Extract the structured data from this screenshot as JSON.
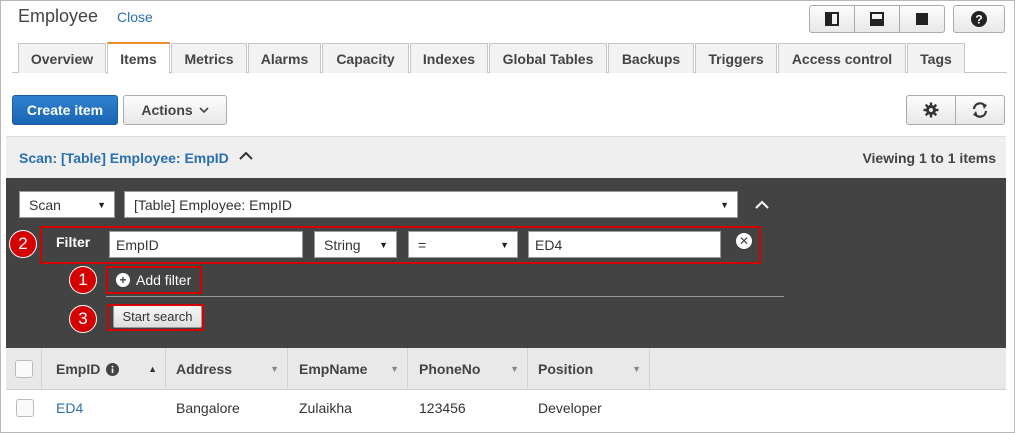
{
  "header": {
    "title": "Employee",
    "close_label": "Close"
  },
  "tabs": [
    {
      "label": "Overview"
    },
    {
      "label": "Items"
    },
    {
      "label": "Metrics"
    },
    {
      "label": "Alarms"
    },
    {
      "label": "Capacity"
    },
    {
      "label": "Indexes"
    },
    {
      "label": "Global Tables"
    },
    {
      "label": "Backups"
    },
    {
      "label": "Triggers"
    },
    {
      "label": "Access control"
    },
    {
      "label": "Tags"
    }
  ],
  "active_tab": "Items",
  "toolbar": {
    "create_label": "Create item",
    "actions_label": "Actions"
  },
  "scan_header": {
    "title": "Scan: [Table] Employee: EmpID",
    "viewing": "Viewing 1 to 1 items"
  },
  "query": {
    "mode": "Scan",
    "source": "[Table] Employee: EmpID",
    "filter_label": "Filter",
    "filter": {
      "attribute": "EmpID",
      "type": "String",
      "operator": "=",
      "value": "ED4"
    },
    "add_filter_label": "Add filter",
    "start_search_label": "Start search"
  },
  "markers": {
    "m1": "1",
    "m2": "2",
    "m3": "3"
  },
  "table": {
    "columns": [
      "EmpID",
      "Address",
      "EmpName",
      "PhoneNo",
      "Position"
    ],
    "rows": [
      {
        "EmpID": "ED4",
        "Address": "Bangalore",
        "EmpName": "Zulaikha",
        "PhoneNo": "123456",
        "Position": "Developer"
      }
    ]
  },
  "colors": {
    "primary": "#1a66b4",
    "active_tab": "#e98c2b",
    "highlight": "#d50000",
    "panel": "#434343",
    "link": "#2a6fb0"
  }
}
